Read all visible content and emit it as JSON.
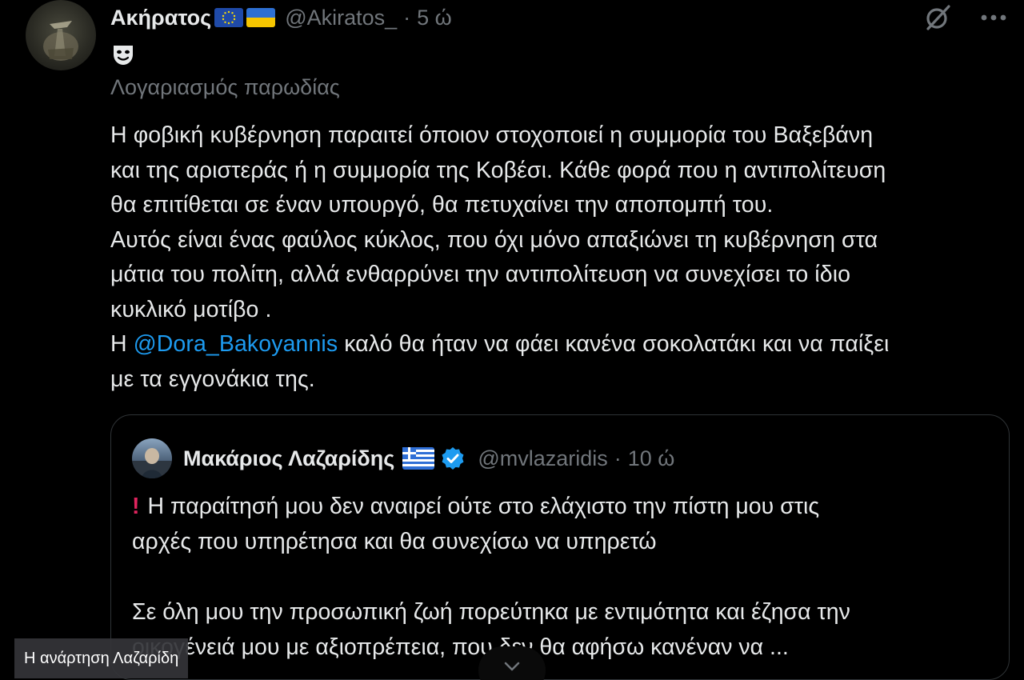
{
  "tweet": {
    "author_name": "Ακήρατος",
    "author_handle": "@Akiratos_",
    "separator": "·",
    "time": "5 ώ",
    "parody_label": "Λογαριασμός παρωδίας",
    "body_lines": [
      "Η φοβική κυβέρνηση παραιτεί όποιον στοχοποιεί η συμμορία του Βαξεβάνη",
      "και της αριστεράς ή η συμμορία της Κοβέσι. Κάθε φορά που η αντιπολίτευση",
      "θα επιτίθεται σε έναν υπουργό, θα πετυχαίνει την αποπομπή του.",
      "Αυτός είναι ένας φαύλος κύκλος, που όχι μόνο απαξιώνει τη κυβέρνηση στα",
      "μάτια του πολίτη, αλλά ενθαρρύνει την αντιπολίτευση να συνεχίσει το ίδιο",
      "κυκλικό μοτίβο ."
    ],
    "mention_line_prefix": "Η ",
    "mention": "@Dora_Bakoyannis",
    "mention_line_suffix": " καλό θα ήταν να φάει κανένα σοκολατάκι και να παίξει",
    "last_line": "με τα εγγονάκια της.",
    "icons": [
      "eu-flag-icon",
      "ukraine-flag-icon",
      "grok-icon",
      "more-icon",
      "mask-icon"
    ]
  },
  "quoted_tweet": {
    "author_name": "Μακάριος Λαζαρίδης",
    "author_handle": "@mvlazaridis",
    "separator": "·",
    "time": "10 ώ",
    "line1": "Η παραίτησή μου δεν αναιρεί ούτε στο ελάχιστο την πίστη μου στις",
    "line2": "αρχές που υπηρέτησα και θα συνεχίσω να υπηρετώ",
    "line3": "Σε όλη μου την προσωπική ζωή πορεύτηκα με εντιμότητα και έζησα την",
    "line4": "οικογένειά μου με αξιοπρέπεια, που δεν θα αφήσω κανέναν να ...",
    "icons": [
      "greece-flag-icon",
      "verified-badge-icon",
      "exclamation-icon"
    ]
  },
  "caption": "Η ανάρτηση Λαζαρίδη",
  "colors": {
    "background": "#000000",
    "text": "#e7e9ea",
    "muted": "#71767b",
    "link": "#1d9bf0",
    "border": "#2f3336"
  }
}
